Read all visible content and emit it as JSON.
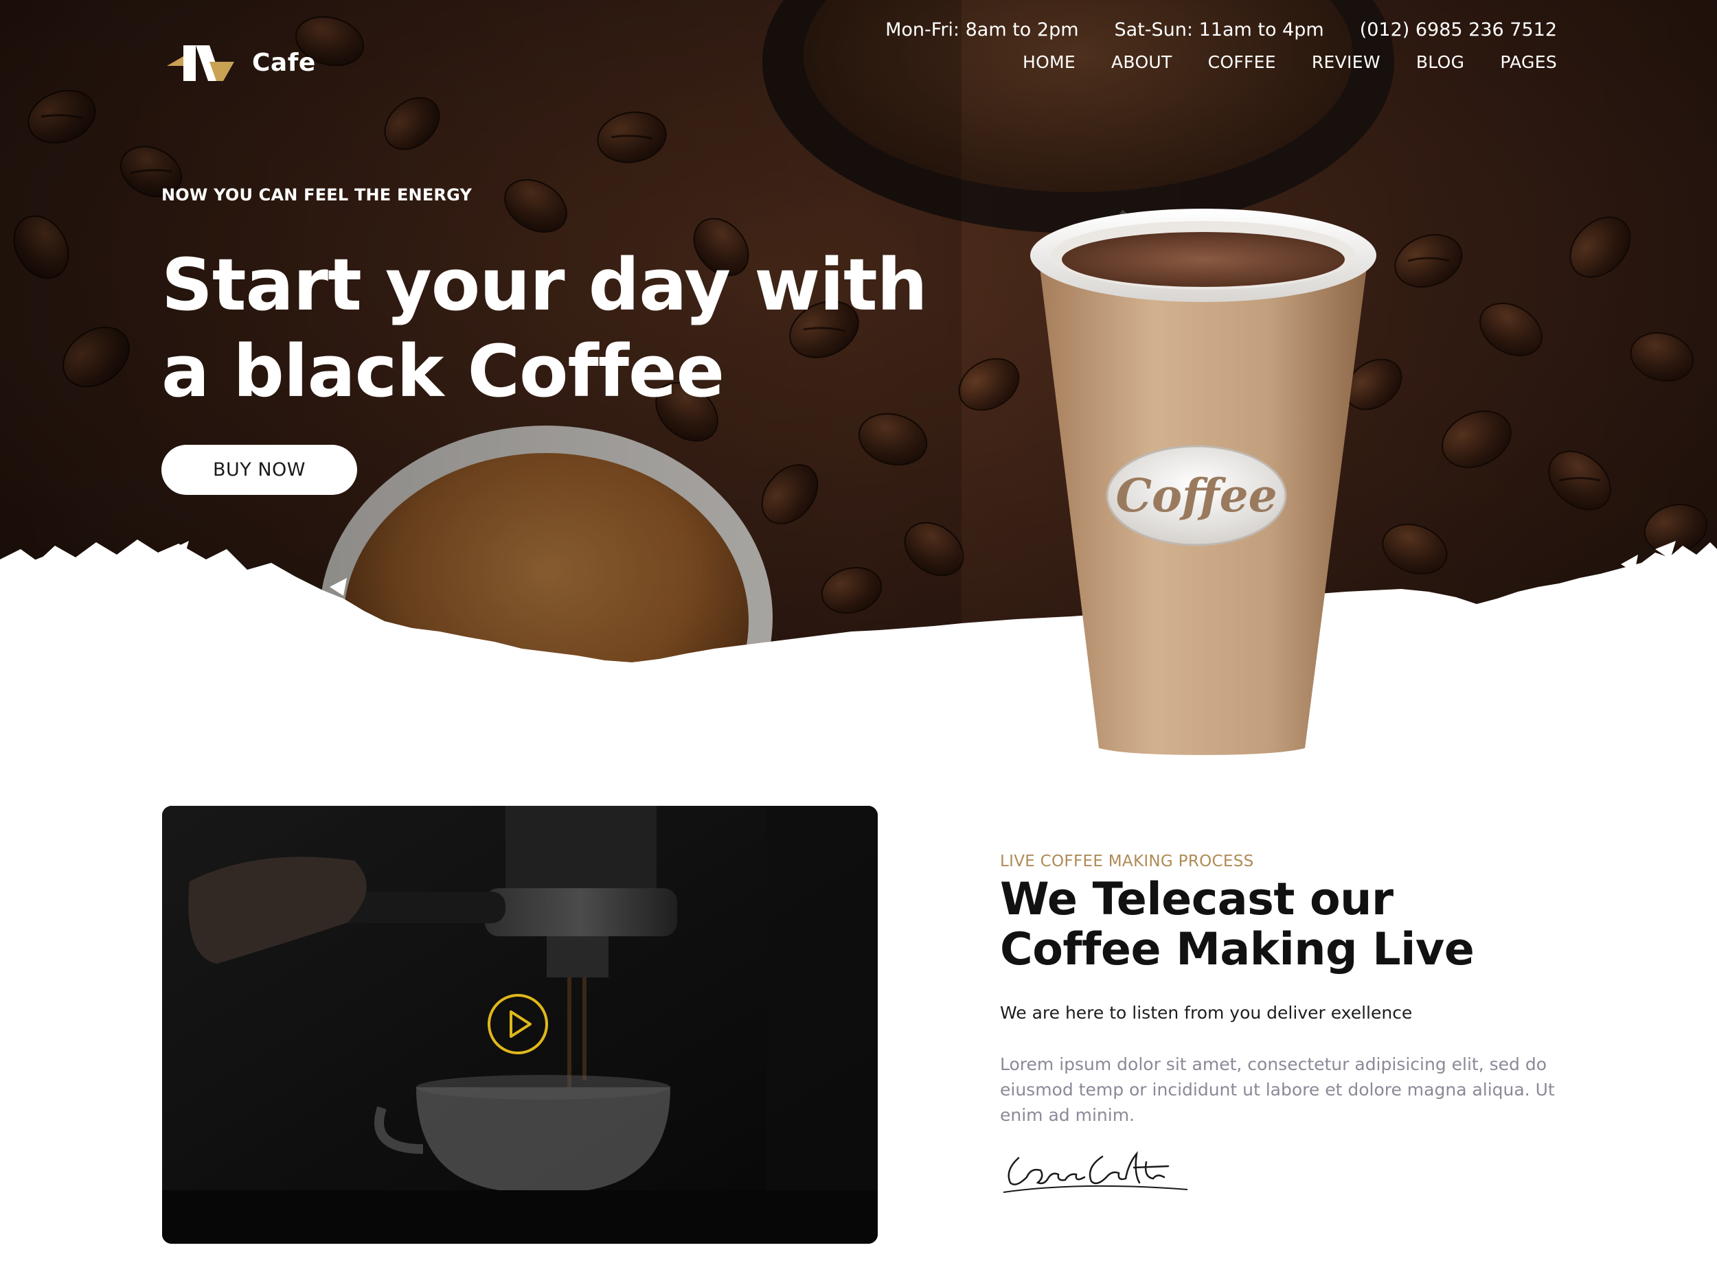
{
  "brand": {
    "name": "Cafe",
    "logo_icon": "m-logo-icon"
  },
  "top_info": {
    "weekday_hours": "Mon-Fri: 8am to 2pm",
    "weekend_hours": "Sat-Sun: 11am to 4pm",
    "phone": "(012) 6985 236 7512"
  },
  "nav": [
    {
      "label": "HOME"
    },
    {
      "label": "ABOUT"
    },
    {
      "label": "COFFEE"
    },
    {
      "label": "REVIEW"
    },
    {
      "label": "BLOG"
    },
    {
      "label": "PAGES"
    }
  ],
  "hero": {
    "eyebrow": "NOW YOU CAN FEEL THE ENERGY",
    "headline_line1": "Start your day with",
    "headline_line2": "a black Coffee",
    "button_label": "BUY NOW",
    "cup_label": "Coffee"
  },
  "live_section": {
    "label": "LIVE COFFEE MAKING PROCESS",
    "title_line1": "We Telecast our",
    "title_line2": "Coffee Making Live",
    "tagline": "We are here to listen from you deliver exellence",
    "body": "Lorem ipsum dolor sit amet, consectetur adipisicing elit, sed do eiusmod temp or incididunt ut labore et dolore magna aliqua. Ut enim ad minim.",
    "signature": "CaraCraft"
  },
  "colors": {
    "accent": "#b08a57",
    "play": "#e0b81a",
    "hero_dark": "#2a1710"
  }
}
